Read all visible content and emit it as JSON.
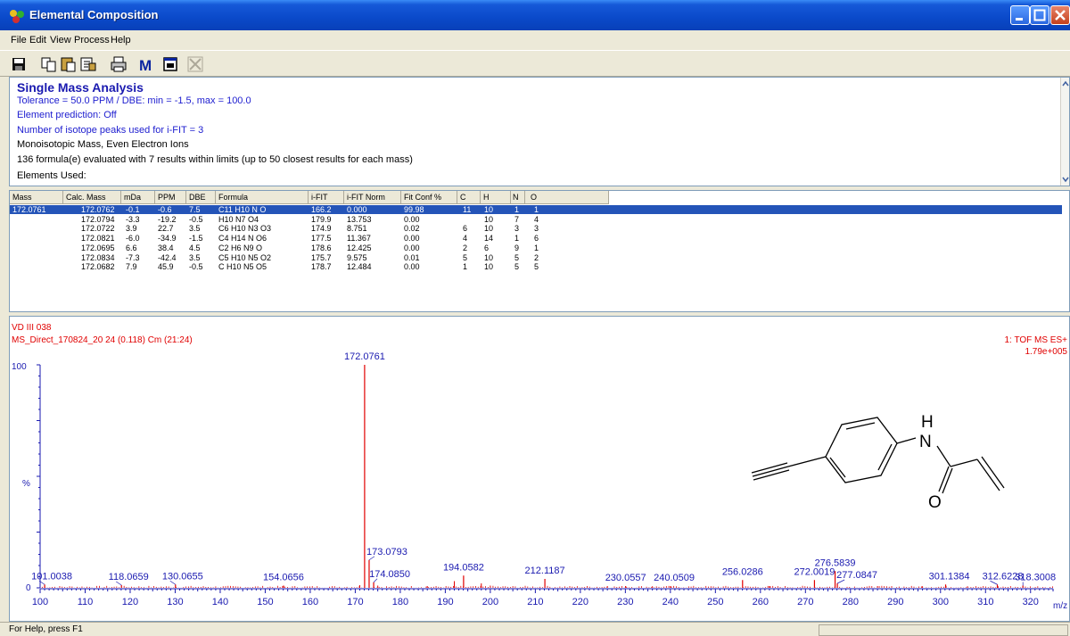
{
  "window": {
    "title": "Elemental Composition"
  },
  "menu": [
    "File",
    "Edit",
    "View",
    "Process",
    "Help"
  ],
  "toolbar": {
    "icons": [
      "save-icon",
      "copy-icon",
      "paste-icon",
      "copy-special-icon",
      "print-icon",
      "m-icon",
      "window-icon",
      "close-x-icon"
    ],
    "m_label": "M"
  },
  "info": {
    "heading": "Single Mass Analysis",
    "tolerance": "Tolerance = 50.0 PPM   /   DBE: min = -1.5, max = 100.0",
    "prediction": "Element prediction: Off",
    "isotope": "Number of isotope peaks used for i-FIT = 3",
    "mono": "Monoisotopic Mass, Even Electron Ions",
    "evaluated": "136 formula(e) evaluated with 7 results within limits (up to 50 closest results for each mass)",
    "elements": "Elements Used:"
  },
  "table": {
    "headers": [
      "Mass",
      "Calc. Mass",
      "mDa",
      "PPM",
      "DBE",
      "Formula",
      "i-FIT",
      "i-FIT Norm",
      "Fit Conf %",
      "C",
      "H",
      "N",
      "O"
    ],
    "rows": [
      [
        "172.0761",
        "172.0762",
        "-0.1",
        "-0.6",
        "7.5",
        "C11 H10 N O",
        "166.2",
        "0.000",
        "99.98",
        "11",
        "10",
        "1",
        "1"
      ],
      [
        "",
        "172.0794",
        "-3.3",
        "-19.2",
        "-0.5",
        "H10 N7 O4",
        "179.9",
        "13.753",
        "0.00",
        "",
        "10",
        "7",
        "4"
      ],
      [
        "",
        "172.0722",
        "3.9",
        "22.7",
        "3.5",
        "C6 H10 N3 O3",
        "174.9",
        "8.751",
        "0.02",
        "6",
        "10",
        "3",
        "3"
      ],
      [
        "",
        "172.0821",
        "-6.0",
        "-34.9",
        "-1.5",
        "C4 H14 N O6",
        "177.5",
        "11.367",
        "0.00",
        "4",
        "14",
        "1",
        "6"
      ],
      [
        "",
        "172.0695",
        "6.6",
        "38.4",
        "4.5",
        "C2 H6 N9 O",
        "178.6",
        "12.425",
        "0.00",
        "2",
        "6",
        "9",
        "1"
      ],
      [
        "",
        "172.0834",
        "-7.3",
        "-42.4",
        "3.5",
        "C5 H10 N5 O2",
        "175.7",
        "9.575",
        "0.01",
        "5",
        "10",
        "5",
        "2"
      ],
      [
        "",
        "172.0682",
        "7.9",
        "45.9",
        "-0.5",
        "C H10 N5 O5",
        "178.7",
        "12.484",
        "0.00",
        "1",
        "10",
        "5",
        "5"
      ]
    ]
  },
  "spectrum": {
    "sample": "VD III 038",
    "scan": "MS_Direct_170824_20 24 (0.118) Cm (21:24)",
    "mode": "1: TOF MS ES+",
    "intensity": "1.79e+005",
    "y_top": "100",
    "y_mid": "%",
    "y_zero": "0",
    "x_unit": "m/z",
    "structure_labels": {
      "h": "H",
      "n": "N",
      "o": "O"
    }
  },
  "chart_data": {
    "type": "bar",
    "xlabel": "m/z",
    "ylabel": "%",
    "xlim": [
      100,
      325
    ],
    "ylim": [
      0,
      100
    ],
    "x_ticks": [
      100,
      110,
      120,
      130,
      140,
      150,
      160,
      170,
      180,
      190,
      200,
      210,
      220,
      230,
      240,
      250,
      260,
      270,
      280,
      290,
      300,
      310,
      320
    ],
    "labeled_peaks": [
      {
        "x": 101.0038,
        "y": 1.5,
        "label": "101.0038"
      },
      {
        "x": 118.0659,
        "y": 1.2,
        "label": "118.0659"
      },
      {
        "x": 130.0655,
        "y": 1.5,
        "label": "130.0655"
      },
      {
        "x": 154.0656,
        "y": 1.0,
        "label": "154.0656"
      },
      {
        "x": 172.0761,
        "y": 100,
        "label": "172.0761"
      },
      {
        "x": 173.0793,
        "y": 12.5,
        "label": "173.0793"
      },
      {
        "x": 174.085,
        "y": 2.5,
        "label": "174.0850"
      },
      {
        "x": 194.0582,
        "y": 5.5,
        "label": "194.0582"
      },
      {
        "x": 212.1187,
        "y": 4.0,
        "label": "212.1187"
      },
      {
        "x": 230.0557,
        "y": 0.8,
        "label": "230.0557"
      },
      {
        "x": 240.0509,
        "y": 0.8,
        "label": "240.0509"
      },
      {
        "x": 256.0286,
        "y": 3.5,
        "label": "256.0286"
      },
      {
        "x": 272.0019,
        "y": 3.5,
        "label": "272.0019"
      },
      {
        "x": 276.5839,
        "y": 7.5,
        "label": "276.5839"
      },
      {
        "x": 277.0847,
        "y": 2.0,
        "label": "277.0847"
      },
      {
        "x": 301.1384,
        "y": 1.5,
        "label": "301.1384"
      },
      {
        "x": 312.6228,
        "y": 1.5,
        "label": "312.6228"
      },
      {
        "x": 318.3008,
        "y": 1.0,
        "label": "318.3008"
      }
    ],
    "minor_peaks": [
      {
        "x": 192.0,
        "y": 3.0
      },
      {
        "x": 198.0,
        "y": 2.0
      },
      {
        "x": 200.0,
        "y": 1.0
      },
      {
        "x": 171.0,
        "y": 1.2
      },
      {
        "x": 175.0,
        "y": 1.0
      },
      {
        "x": 186.0,
        "y": 0.8
      },
      {
        "x": 226.0,
        "y": 0.8
      },
      {
        "x": 236.0,
        "y": 0.7
      },
      {
        "x": 262.0,
        "y": 0.8
      },
      {
        "x": 286.0,
        "y": 0.8
      },
      {
        "x": 296.0,
        "y": 0.7
      },
      {
        "x": 306.0,
        "y": 0.7
      }
    ]
  },
  "status": {
    "text": "For Help, press F1"
  },
  "colors": {
    "title_blue": "#0a49c9",
    "spectrum_red": "#e00000",
    "axis_blue": "#1a1ab0",
    "selection": "#2454b8"
  }
}
